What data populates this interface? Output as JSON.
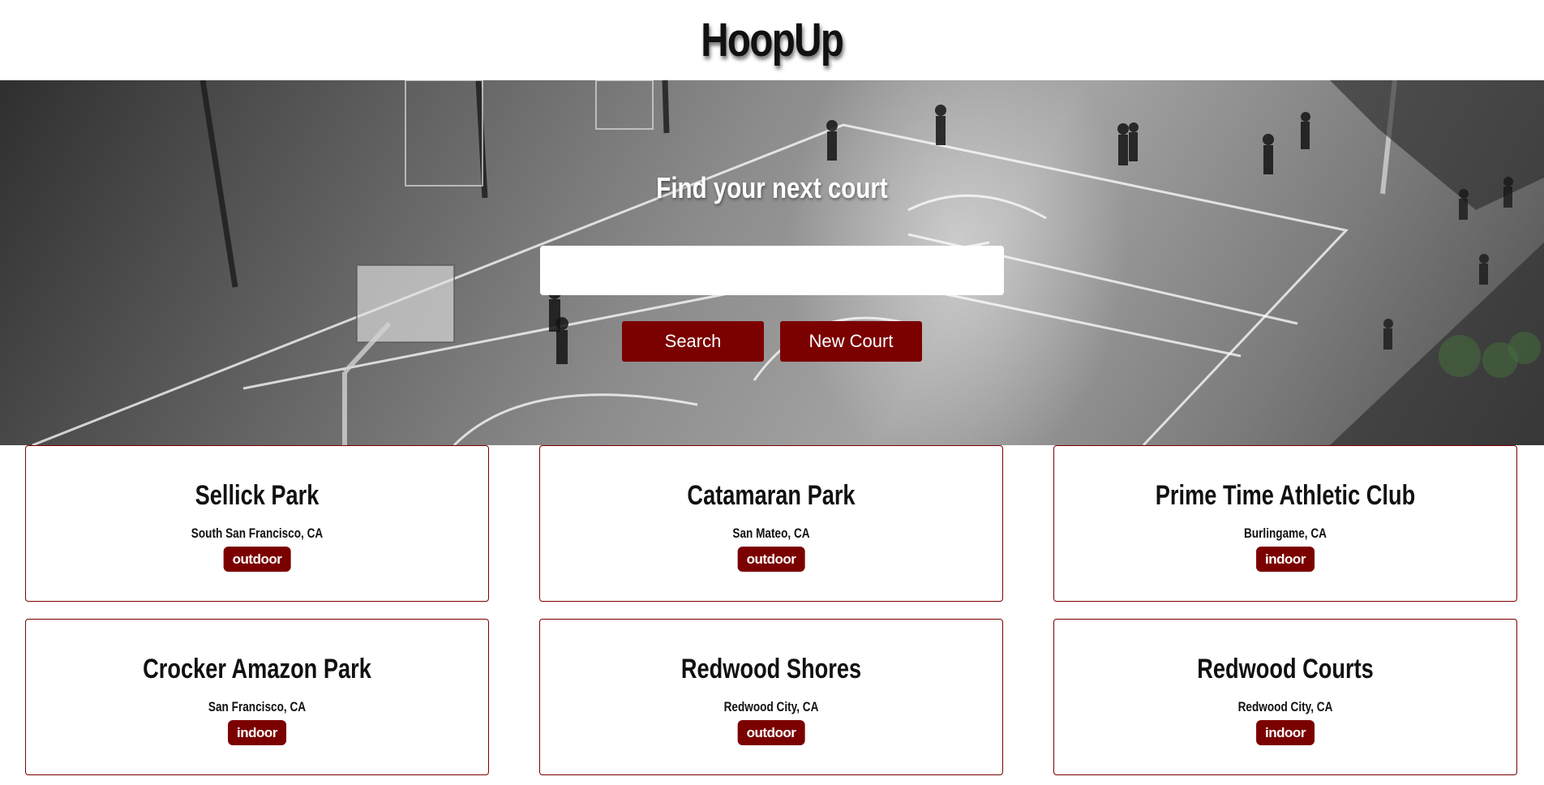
{
  "header": {
    "logo": "HoopUp"
  },
  "hero": {
    "title": "Find your next court",
    "search": {
      "value": "",
      "placeholder": ""
    },
    "search_button": "Search",
    "new_court_button": "New Court"
  },
  "courts": [
    {
      "name": "Sellick Park",
      "location": "South San Francisco, CA",
      "type": "outdoor"
    },
    {
      "name": "Catamaran Park",
      "location": "San Mateo, CA",
      "type": "outdoor"
    },
    {
      "name": "Prime Time Athletic Club",
      "location": "Burlingame, CA",
      "type": "indoor"
    },
    {
      "name": "Crocker Amazon Park",
      "location": "San Francisco, CA",
      "type": "indoor"
    },
    {
      "name": "Redwood Shores",
      "location": "Redwood City, CA",
      "type": "outdoor"
    },
    {
      "name": "Redwood Courts",
      "location": "Redwood City, CA",
      "type": "indoor"
    }
  ],
  "colors": {
    "accent": "#7b0000",
    "background": "#ffffff"
  }
}
